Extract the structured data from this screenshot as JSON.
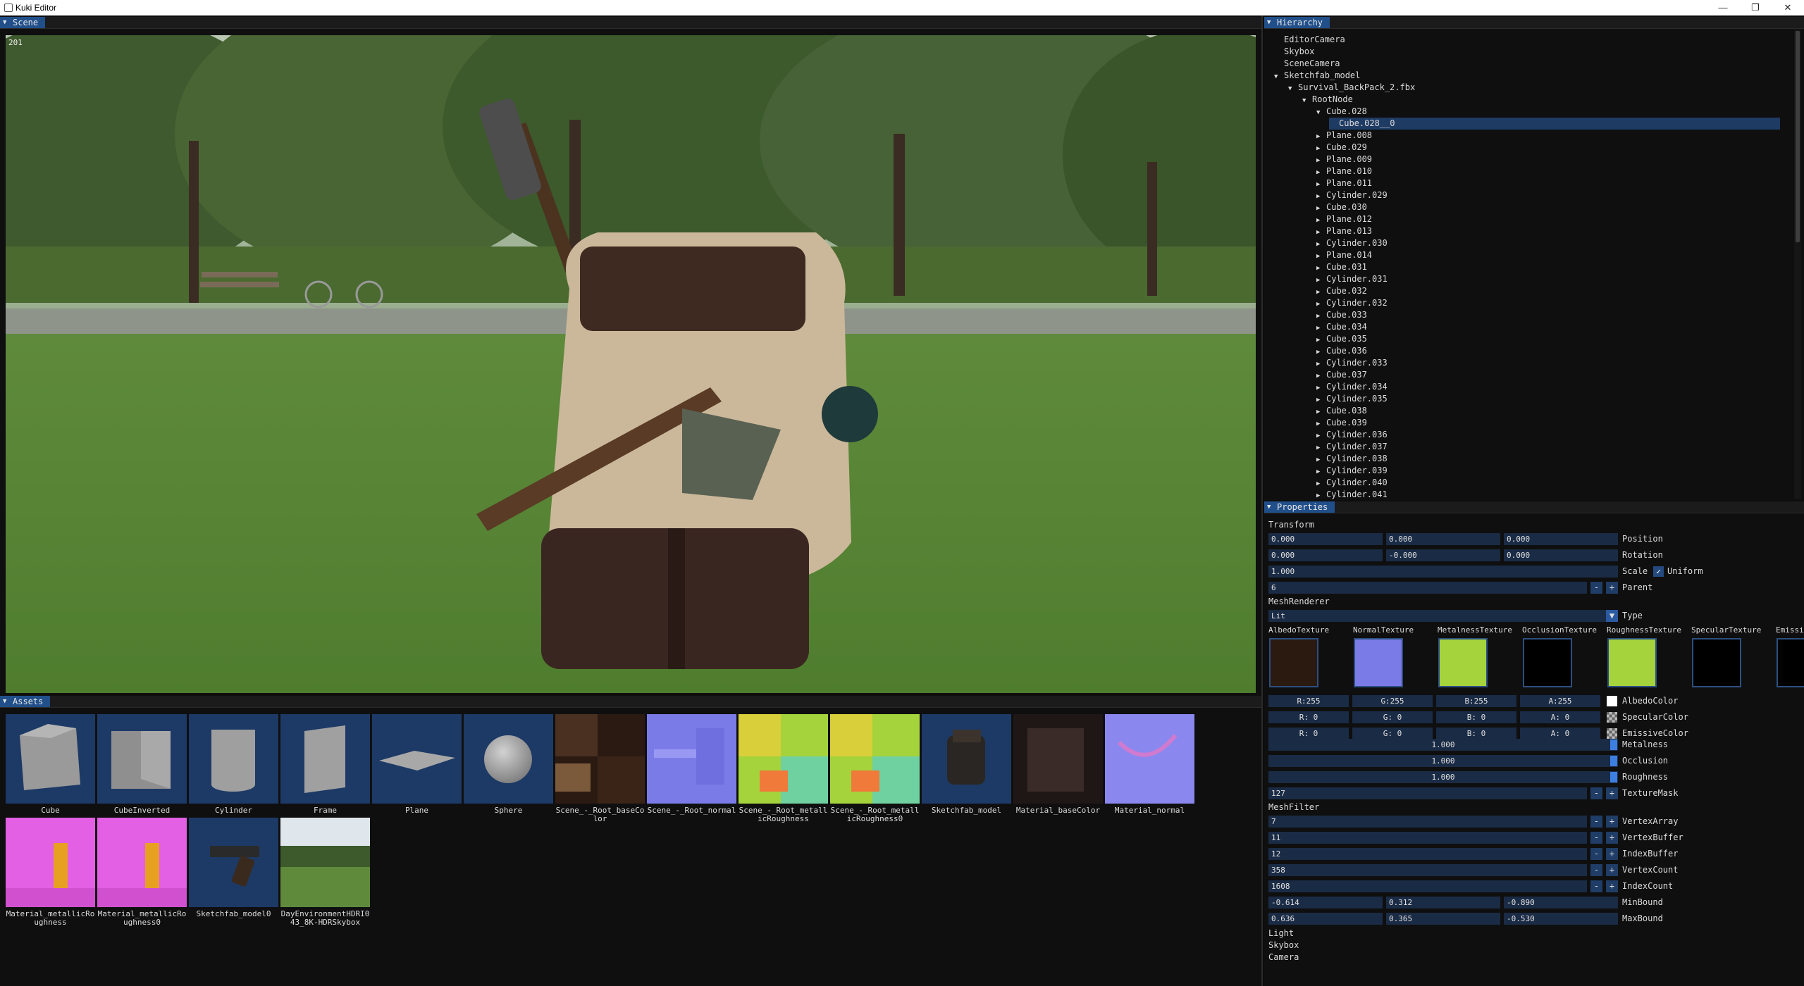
{
  "window": {
    "title": "Kuki Editor",
    "minimize": "—",
    "restore": "❐",
    "close": "✕"
  },
  "scene": {
    "tab": "Scene",
    "fps": "201"
  },
  "hierarchy": {
    "tab": "Hierarchy",
    "rows": [
      {
        "label": "EditorCamera",
        "indent": 0,
        "arrow": ""
      },
      {
        "label": "Skybox",
        "indent": 0,
        "arrow": ""
      },
      {
        "label": "SceneCamera",
        "indent": 0,
        "arrow": ""
      },
      {
        "label": "Sketchfab_model",
        "indent": 0,
        "arrow": "▼"
      },
      {
        "label": "Survival_BackPack_2.fbx",
        "indent": 1,
        "arrow": "▼"
      },
      {
        "label": "RootNode",
        "indent": 2,
        "arrow": "▼"
      },
      {
        "label": "Cube.028",
        "indent": 3,
        "arrow": "▼"
      },
      {
        "label": "Cube.028__0",
        "indent": 4,
        "arrow": "",
        "selected": true
      },
      {
        "label": "Plane.008",
        "indent": 3,
        "arrow": "▶"
      },
      {
        "label": "Cube.029",
        "indent": 3,
        "arrow": "▶"
      },
      {
        "label": "Plane.009",
        "indent": 3,
        "arrow": "▶"
      },
      {
        "label": "Plane.010",
        "indent": 3,
        "arrow": "▶"
      },
      {
        "label": "Plane.011",
        "indent": 3,
        "arrow": "▶"
      },
      {
        "label": "Cylinder.029",
        "indent": 3,
        "arrow": "▶"
      },
      {
        "label": "Cube.030",
        "indent": 3,
        "arrow": "▶"
      },
      {
        "label": "Plane.012",
        "indent": 3,
        "arrow": "▶"
      },
      {
        "label": "Plane.013",
        "indent": 3,
        "arrow": "▶"
      },
      {
        "label": "Cylinder.030",
        "indent": 3,
        "arrow": "▶"
      },
      {
        "label": "Plane.014",
        "indent": 3,
        "arrow": "▶"
      },
      {
        "label": "Cube.031",
        "indent": 3,
        "arrow": "▶"
      },
      {
        "label": "Cylinder.031",
        "indent": 3,
        "arrow": "▶"
      },
      {
        "label": "Cube.032",
        "indent": 3,
        "arrow": "▶"
      },
      {
        "label": "Cylinder.032",
        "indent": 3,
        "arrow": "▶"
      },
      {
        "label": "Cube.033",
        "indent": 3,
        "arrow": "▶"
      },
      {
        "label": "Cube.034",
        "indent": 3,
        "arrow": "▶"
      },
      {
        "label": "Cube.035",
        "indent": 3,
        "arrow": "▶"
      },
      {
        "label": "Cube.036",
        "indent": 3,
        "arrow": "▶"
      },
      {
        "label": "Cylinder.033",
        "indent": 3,
        "arrow": "▶"
      },
      {
        "label": "Cube.037",
        "indent": 3,
        "arrow": "▶"
      },
      {
        "label": "Cylinder.034",
        "indent": 3,
        "arrow": "▶"
      },
      {
        "label": "Cylinder.035",
        "indent": 3,
        "arrow": "▶"
      },
      {
        "label": "Cube.038",
        "indent": 3,
        "arrow": "▶"
      },
      {
        "label": "Cube.039",
        "indent": 3,
        "arrow": "▶"
      },
      {
        "label": "Cylinder.036",
        "indent": 3,
        "arrow": "▶"
      },
      {
        "label": "Cylinder.037",
        "indent": 3,
        "arrow": "▶"
      },
      {
        "label": "Cylinder.038",
        "indent": 3,
        "arrow": "▶"
      },
      {
        "label": "Cylinder.039",
        "indent": 3,
        "arrow": "▶"
      },
      {
        "label": "Cylinder.040",
        "indent": 3,
        "arrow": "▶"
      },
      {
        "label": "Cylinder.041",
        "indent": 3,
        "arrow": "▶"
      }
    ]
  },
  "assets": {
    "tab": "Assets",
    "items": [
      {
        "label": "Cube",
        "thumb": "cube"
      },
      {
        "label": "CubeInverted",
        "thumb": "cube-inverted"
      },
      {
        "label": "Cylinder",
        "thumb": "cylinder"
      },
      {
        "label": "Frame",
        "thumb": "frame"
      },
      {
        "label": "Plane",
        "thumb": "plane"
      },
      {
        "label": "Sphere",
        "thumb": "sphere"
      },
      {
        "label": "Scene_-_Root_baseColor",
        "thumb": "basecolor"
      },
      {
        "label": "Scene_-_Root_normal",
        "thumb": "normal"
      },
      {
        "label": "Scene_-_Root_metallicRoughness",
        "thumb": "metalrough"
      },
      {
        "label": "Scene_-_Root_metallicRoughness0",
        "thumb": "metalrough"
      },
      {
        "label": "Sketchfab_model",
        "thumb": "backpack"
      },
      {
        "label": "Material_baseColor",
        "thumb": "material-base"
      },
      {
        "label": "Material_normal",
        "thumb": "material-normal"
      },
      {
        "label": "Material_metallicRoughness",
        "thumb": "magenta"
      },
      {
        "label": "Material_metallicRoughness0",
        "thumb": "magenta"
      },
      {
        "label": "Sketchfab_model0",
        "thumb": "revolver"
      },
      {
        "label": "DayEnvironmentHDRI043_8K-HDRSkybox",
        "thumb": "skybox"
      }
    ]
  },
  "properties": {
    "tab": "Properties",
    "transform": {
      "header": "Transform",
      "position": [
        "0.000",
        "0.000",
        "0.000"
      ],
      "position_label": "Position",
      "rotation": [
        "0.000",
        "-0.000",
        "0.000"
      ],
      "rotation_label": "Rotation",
      "scale": "1.000",
      "scale_label": "Scale",
      "uniform_label": "Uniform",
      "uniform_checked": "✓",
      "parent": "6",
      "parent_label": "Parent"
    },
    "mesh_renderer": {
      "header": "MeshRenderer",
      "type_value": "Lit",
      "type_label": "Type",
      "textures": [
        "AlbedoTexture",
        "NormalTexture",
        "MetalnessTexture",
        "OcclusionTexture",
        "RoughnessTexture",
        "SpecularTexture",
        "EmissiveTexture"
      ],
      "albedo": {
        "r": "R:255",
        "g": "G:255",
        "b": "B:255",
        "a": "A:255",
        "label": "AlbedoColor",
        "swatch": "#ffffff"
      },
      "specular": {
        "r": "R:  0",
        "g": "G:  0",
        "b": "B:  0",
        "a": "A:  0",
        "label": "SpecularColor"
      },
      "emissive": {
        "r": "R:  0",
        "g": "G:  0",
        "b": "B:  0",
        "a": "A:  0",
        "label": "EmissiveColor"
      },
      "metalness": "1.000",
      "metalness_label": "Metalness",
      "occlusion": "1.000",
      "occlusion_label": "Occlusion",
      "roughness": "1.000",
      "roughness_label": "Roughness",
      "texture_mask": "127",
      "texture_mask_label": "TextureMask"
    },
    "mesh_filter": {
      "header": "MeshFilter",
      "vertex_array": "7",
      "vertex_array_label": "VertexArray",
      "vertex_buffer": "11",
      "vertex_buffer_label": "VertexBuffer",
      "index_buffer": "12",
      "index_buffer_label": "IndexBuffer",
      "vertex_count": "358",
      "vertex_count_label": "VertexCount",
      "index_count": "1608",
      "index_count_label": "IndexCount",
      "min_bound": [
        "-0.614",
        "0.312",
        "-0.890"
      ],
      "min_bound_label": "MinBound",
      "max_bound": [
        "0.636",
        "0.365",
        "-0.530"
      ],
      "max_bound_label": "MaxBound"
    },
    "components": [
      "Light",
      "Skybox",
      "Camera"
    ],
    "minus": "-",
    "plus": "+",
    "dropdown_arrow": "▼"
  },
  "colors": {
    "tab_active": "#214f8a",
    "field_bg": "#1a2b45",
    "selection": "#1e3b63",
    "slider_grab": "#3d7fe0"
  }
}
